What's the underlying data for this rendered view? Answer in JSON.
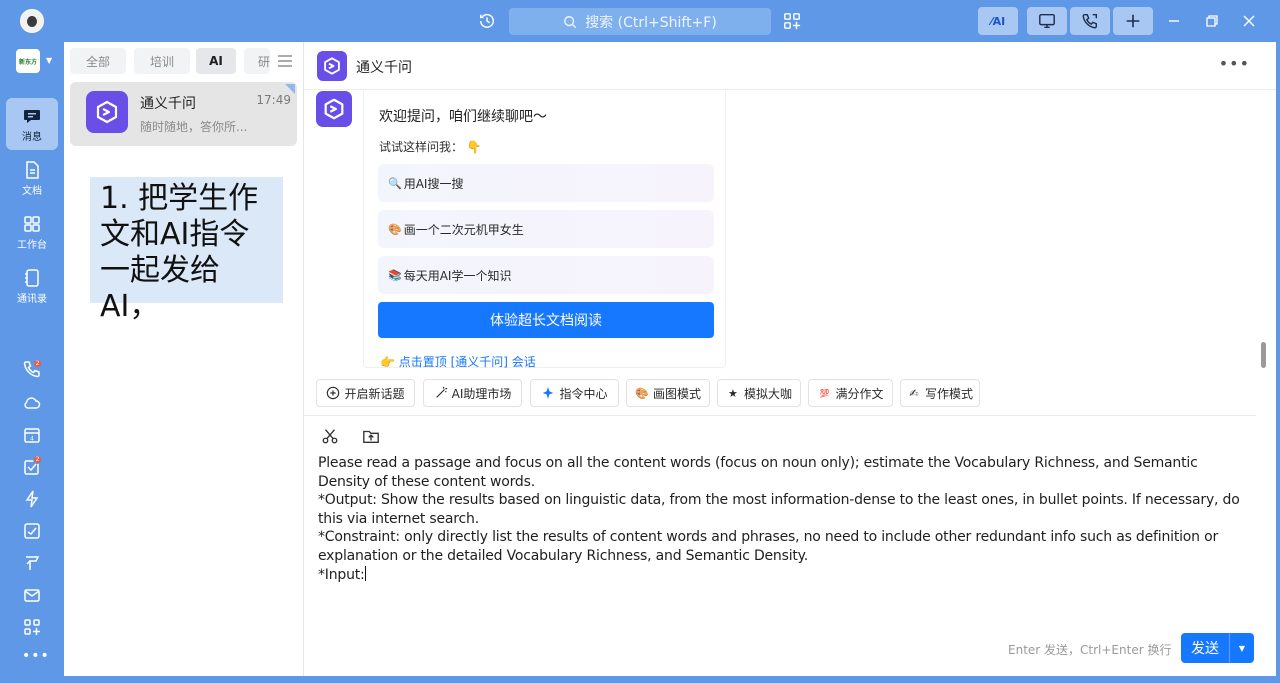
{
  "titlebar": {
    "search_placeholder": "搜索 (Ctrl+Shift+F)",
    "ai_button_label": "⁄AI"
  },
  "org": {
    "logo_text": "新东方"
  },
  "nav": {
    "items": [
      {
        "label": "消息",
        "icon": "chat-bubble-icon",
        "active": true
      },
      {
        "label": "文档",
        "icon": "document-icon"
      },
      {
        "label": "工作台",
        "icon": "grid-icon"
      },
      {
        "label": "通讯录",
        "icon": "contacts-icon"
      }
    ],
    "phone_badge": "2",
    "tasks_badge": "2",
    "calendar_day": "4"
  },
  "filters": [
    "全部",
    "培训",
    "AI",
    "研"
  ],
  "conversation": {
    "name": "通义千问",
    "time": "17:49",
    "preview": "随时随地，答你所..."
  },
  "caption": "1. 把学生作文和AI指令一起发给AI，",
  "chat": {
    "title": "通义千问",
    "welcome": "欢迎提问，咱们继续聊吧～",
    "try_ask": "试试这样问我：",
    "suggestions": [
      {
        "emoji": "🔍",
        "text": "用AI搜一搜"
      },
      {
        "emoji": "🎨",
        "text": "画一个二次元机甲女生"
      },
      {
        "emoji": "📚",
        "text": "每天用AI学一个知识"
      }
    ],
    "cta": "体验超长文档阅读",
    "pin_link": "👉 点击置顶 [通义千问] 会话"
  },
  "toolbar": [
    {
      "icon": "plus-circle-icon",
      "label": "开启新话题"
    },
    {
      "icon": "magic-wand-icon",
      "label": "AI助理市场"
    },
    {
      "icon": "sparkle-icon",
      "label": "指令中心"
    },
    {
      "icon": "palette-icon",
      "label": "画图模式"
    },
    {
      "icon": "star-icon",
      "label": "模拟大咖"
    },
    {
      "icon": "score-icon",
      "label": "满分作文"
    },
    {
      "icon": "write-icon",
      "label": "写作模式"
    }
  ],
  "compose": {
    "text": "Please read a passage and focus on all the content words (focus on noun only); estimate the Vocabulary Richness, and Semantic Density of these content words.\n*Output: Show the results based on linguistic data, from the most information-dense to the least ones, in bullet points. If necessary, do this via internet search.\n*Constraint: only directly list the results of content words and phrases, no need to include other redundant info such as definition or explanation or the detailed Vocabulary Richness, and Semantic Density.\n*Input:",
    "hint": "Enter 发送，Ctrl+Enter 换行",
    "send_label": "发送"
  },
  "colors": {
    "chrome_blue": "#5e98e6",
    "primary": "#1677ff",
    "ai_purple": "#6a4ee8"
  }
}
